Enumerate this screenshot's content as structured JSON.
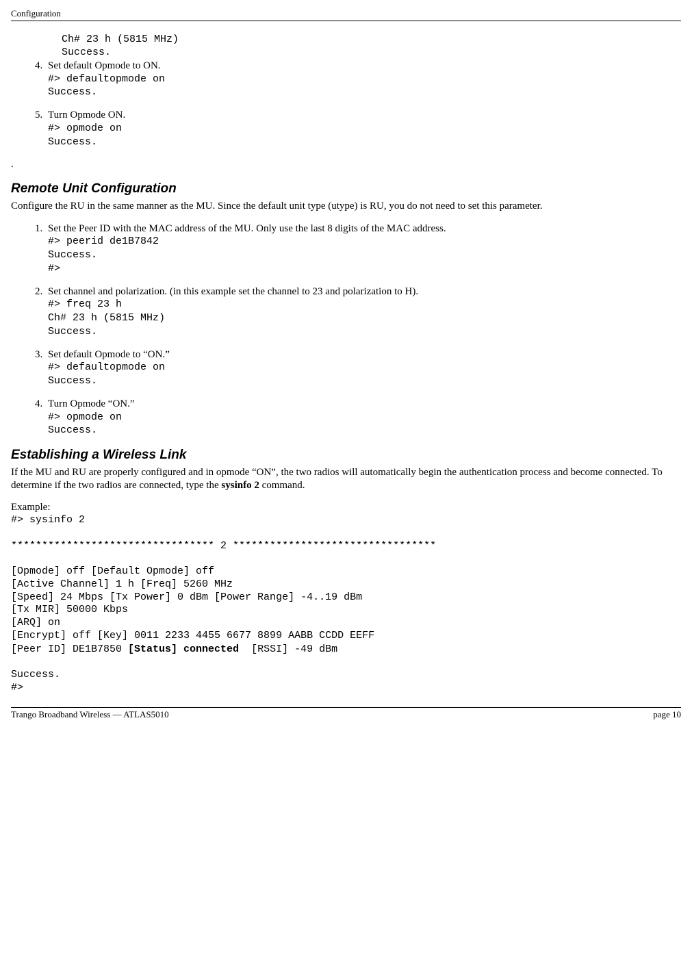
{
  "header": {
    "label": "Configuration"
  },
  "topSteps": {
    "pre": {
      "l1": "Ch# 23 h (5815 MHz)",
      "l2": "Success."
    },
    "s4": {
      "text": "Set default Opmode to ON.",
      "l1": "#> defaultopmode on",
      "l2": "Success."
    },
    "s5": {
      "text": "Turn Opmode ON.",
      "l1": "#> opmode on",
      "l2": "Success."
    }
  },
  "sec1": {
    "title": "Remote Unit Configuration",
    "intro": "Configure the RU in the same manner as the MU.   Since the default unit type (utype) is RU, you do not need to set this parameter."
  },
  "ruSteps": {
    "s1": {
      "text": "Set the Peer ID with the MAC address of the MU.   Only use the last 8 digits of the MAC address.",
      "l1": "#> peerid de1B7842",
      "l2": "Success.",
      "l3": "#>"
    },
    "s2": {
      "text": "Set channel and polarization. (in this example set the channel to 23 and polarization to H).",
      "l1": "#> freq 23 h",
      "l2": "Ch# 23 h (5815 MHz)",
      "l3": "Success."
    },
    "s3": {
      "text": "Set default Opmode to “ON.”",
      "l1": "#> defaultopmode on",
      "l2": "Success."
    },
    "s4": {
      "text": "Turn Opmode “ON.”",
      "l1": "#> opmode on",
      "l2": "Success."
    }
  },
  "sec2": {
    "title": "Establishing a Wireless Link",
    "p1a": "If the MU and RU are properly configured and in opmode “ON”, the two radios will automatically begin the authentication process and become connected.  To determine if the two radios are connected, type the ",
    "p1bold": "sysinfo 2",
    "p1b": " command.",
    "example_label": "Example:",
    "cmd": "#> sysinfo 2",
    "divider": "********************************* 2 *********************************",
    "out1": "[Opmode] off [Default Opmode] off",
    "out2": "[Active Channel] 1 h [Freq] 5260 MHz",
    "out3": "[Speed] 24 Mbps [Tx Power] 0 dBm [Power Range] -4..19 dBm",
    "out4": "[Tx MIR] 50000 Kbps",
    "out5": "[ARQ] on",
    "out6": "[Encrypt] off [Key] 0011 2233 4455 6677 8899 AABB CCDD EEFF",
    "out7a": "[Peer ID] DE1B7850 ",
    "out7bold": "[Status] connected",
    "out7b": "  [RSSI] -49 dBm",
    "out8": "Success.",
    "out9": "#>"
  },
  "footer": {
    "left": "Trango Broadband Wireless — ATLAS5010",
    "right": "page 10"
  }
}
